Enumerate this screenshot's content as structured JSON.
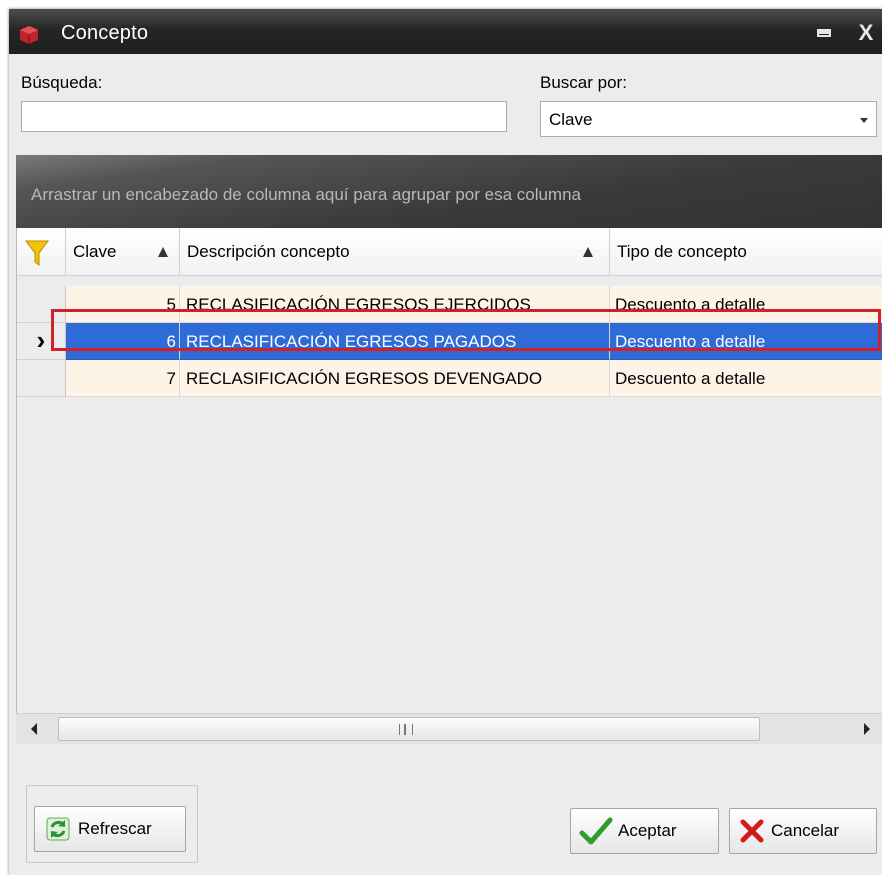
{
  "window": {
    "title": "Concepto",
    "close_glyph": "X"
  },
  "search": {
    "label": "Búsqueda:",
    "value": ""
  },
  "buscar_por": {
    "label": "Buscar por:",
    "selected": "Clave"
  },
  "grid": {
    "group_panel_text": "Arrastrar un encabezado de columna aquí para agrupar por esa columna",
    "columns": {
      "clave": "Clave",
      "descripcion": "Descripción concepto",
      "tipo": "Tipo de concepto"
    },
    "rows": [
      {
        "clave": "5",
        "descripcion": "RECLASIFICACIÓN EGRESOS EJERCIDOS",
        "tipo": "Descuento a detalle"
      },
      {
        "clave": "6",
        "descripcion": "RECLASIFICACIÓN EGRESOS PAGADOS",
        "tipo": "Descuento a detalle",
        "selected": true
      },
      {
        "clave": "7",
        "descripcion": "RECLASIFICACIÓN EGRESOS DEVENGADO",
        "tipo": "Descuento a detalle"
      }
    ],
    "current_row_indicator": "›"
  },
  "buttons": {
    "refresh": "Refrescar",
    "accept": "Aceptar",
    "cancel": "Cancelar"
  },
  "icons": {
    "app": "app-logo-icon",
    "maximize": "maximize-icon",
    "close": "close-icon",
    "filter": "funnel-icon",
    "refresh": "refresh-arrows-icon",
    "accept": "green-check-icon",
    "cancel": "red-x-icon"
  },
  "colors": {
    "selection": "#2f6bd6",
    "highlight_box": "#d1202a",
    "row_alt": "#fdf3e7"
  }
}
